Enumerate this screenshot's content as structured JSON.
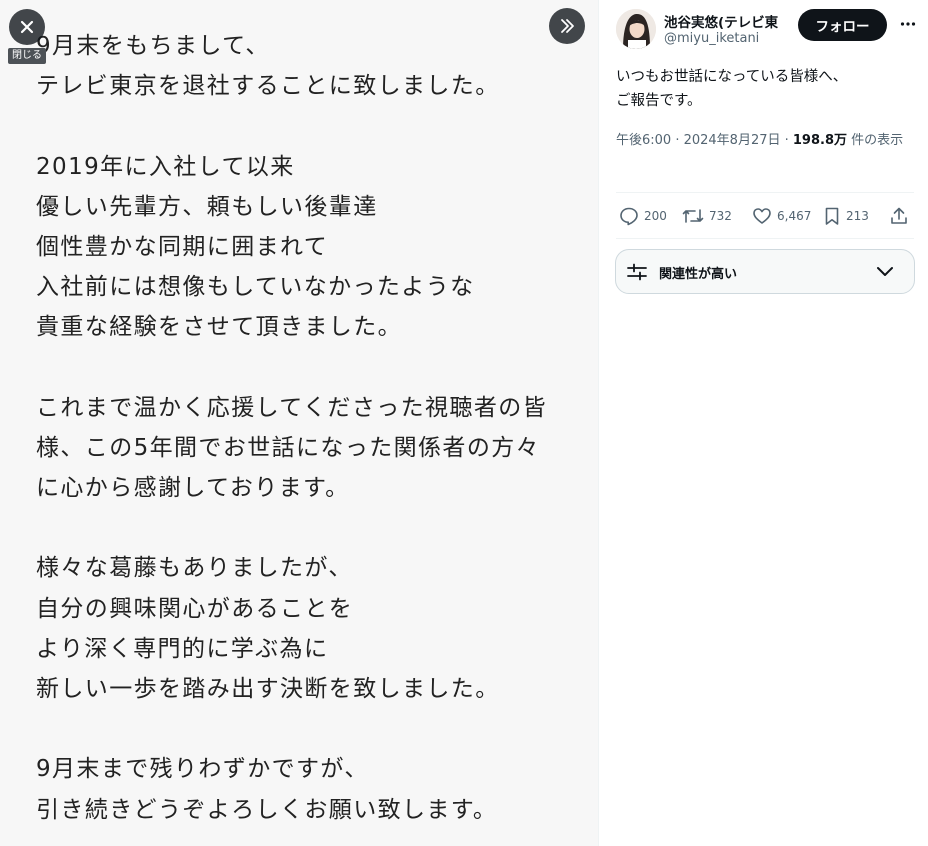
{
  "media": {
    "lines": [
      "9月末をもちまして、",
      "テレビ東京を退社することに致しました。",
      "",
      "2019年に入社して以来",
      "優しい先輩方、頼もしい後輩達",
      "個性豊かな同期に囲まれて",
      "入社前には想像もしていなかったような",
      "貴重な経験をさせて頂きました。",
      "",
      "これまで温かく応援してくださった視聴者の皆",
      "様、この5年間でお世話になった関係者の方々",
      "に心から感謝しております。",
      "",
      "様々な葛藤もありましたが、",
      "自分の興味関心があることを",
      "より深く専門的に学ぶ為に",
      "新しい一歩を踏み出す決断を致しました。",
      "",
      "9月末まで残りわずかですが、",
      "引き続きどうぞよろしくお願い致します。"
    ],
    "close_tooltip": "閉じる",
    "close_icon": "close-icon",
    "expand_icon": "chevron-double-right-icon"
  },
  "tweet": {
    "author_name": "池谷実悠(テレビ東",
    "author_handle": "@miyu_iketani",
    "follow_label": "フォロー",
    "more_icon": "more-horizontal-icon",
    "text_lines": [
      "いつもお世話になっている皆様へ、",
      "ご報告です。"
    ],
    "timestamp": "午後6:00 · 2024年8月27日 · ",
    "views_count": "198.8万",
    "views_label": " 件の表示",
    "actions": {
      "replies": "200",
      "reposts": "732",
      "likes": "6,467",
      "bookmarks": "213"
    },
    "related_label": "関連性が高い",
    "colors": {
      "text": "#0f1419",
      "secondary": "#536471",
      "border": "#cfd9de",
      "follow_bg": "#0f1419"
    }
  }
}
